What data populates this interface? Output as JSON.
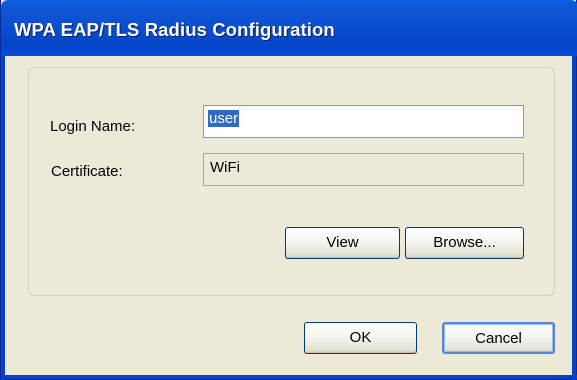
{
  "window": {
    "title": "WPA EAP/TLS Radius Configuration"
  },
  "form": {
    "login_name_label": "Login Name:",
    "login_name_value": "user",
    "certificate_label": "Certificate:",
    "certificate_value": "WiFi"
  },
  "buttons": {
    "view": "View",
    "browse": "Browse...",
    "ok": "OK",
    "cancel": "Cancel"
  },
  "colors": {
    "titlebar": "#0a4fd0",
    "dialog_background": "#ece9d8",
    "selection": "#316ac5"
  }
}
